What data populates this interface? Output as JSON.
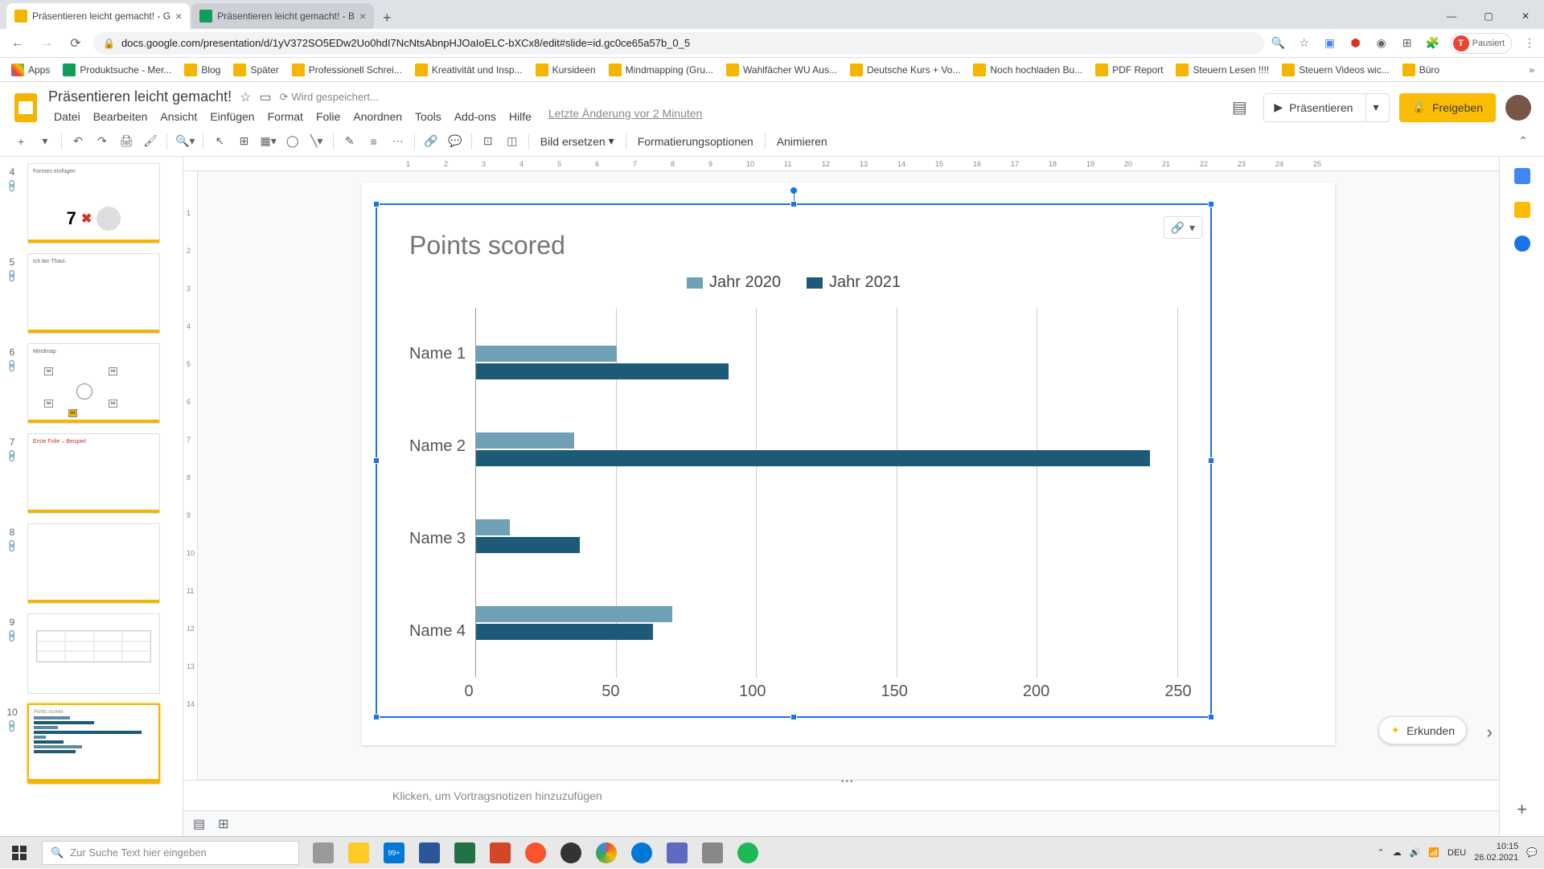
{
  "browser": {
    "tabs": [
      {
        "title": "Präsentieren leicht gemacht! - G",
        "favicon": "slides"
      },
      {
        "title": "Präsentieren leicht gemacht! - B",
        "favicon": "sheets"
      }
    ],
    "url": "docs.google.com/presentation/d/1yV372SO5EDw2Uo0hdI7NcNtsAbnpHJOaIoELC-bXCx8/edit#slide=id.gc0ce65a57b_0_5",
    "profile_status": "Pausiert",
    "bookmarks": [
      "Apps",
      "Produktsuche - Mer...",
      "Blog",
      "Später",
      "Professionell Schrei...",
      "Kreativität und Insp...",
      "Kursideen",
      "Mindmapping  (Gru...",
      "Wahlfächer WU Aus...",
      "Deutsche Kurs + Vo...",
      "Noch hochladen Bu...",
      "PDF Report",
      "Steuern Lesen !!!!",
      "Steuern Videos wic...",
      "Büro"
    ]
  },
  "slides": {
    "doc_title": "Präsentieren leicht gemacht!",
    "save_status": "Wird gespeichert...",
    "menu": [
      "Datei",
      "Bearbeiten",
      "Ansicht",
      "Einfügen",
      "Format",
      "Folie",
      "Anordnen",
      "Tools",
      "Add-ons",
      "Hilfe"
    ],
    "last_edit": "Letzte Änderung vor 2 Minuten",
    "present_label": "Präsentieren",
    "share_label": "Freigeben",
    "toolbar": {
      "replace_image": "Bild ersetzen",
      "format_options": "Formatierungsoptionen",
      "animate": "Animieren"
    },
    "notes_placeholder": "Klicken, um Vortragsnotizen hinzuzufügen",
    "explore_label": "Erkunden",
    "thumbnails": [
      {
        "num": 4,
        "type": "7x",
        "label": "Formen einfügen"
      },
      {
        "num": 5,
        "type": "text",
        "label": "Ich bin Thavi."
      },
      {
        "num": 6,
        "type": "mindmap",
        "label": "Mindmap"
      },
      {
        "num": 7,
        "type": "text-red",
        "label": "Erste Folie – Beispiel"
      },
      {
        "num": 8,
        "type": "blank"
      },
      {
        "num": 9,
        "type": "table"
      },
      {
        "num": 10,
        "type": "chart",
        "selected": true,
        "label": "Points scored"
      }
    ]
  },
  "chart_data": {
    "type": "bar",
    "orientation": "horizontal",
    "title": "Points scored",
    "categories": [
      "Name 1",
      "Name 2",
      "Name 3",
      "Name 4"
    ],
    "series": [
      {
        "name": "Jahr 2020",
        "color": "#6fa0b6",
        "values": [
          50,
          35,
          12,
          70
        ]
      },
      {
        "name": "Jahr 2021",
        "color": "#1c5a78",
        "values": [
          90,
          240,
          37,
          63
        ]
      }
    ],
    "xlabel": "",
    "ylabel": "",
    "xlim": [
      0,
      250
    ],
    "x_ticks": [
      0,
      50,
      100,
      150,
      200,
      250
    ]
  },
  "taskbar": {
    "search_placeholder": "Zur Suche Text hier eingeben",
    "lang": "DEU",
    "time": "10:15",
    "date": "26.02.2021",
    "file_badge": "99+"
  }
}
